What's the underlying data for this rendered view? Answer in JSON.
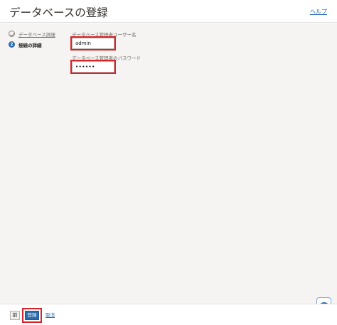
{
  "header": {
    "title": "データベースの登録",
    "help_label": "ヘルプ"
  },
  "steps": [
    {
      "label": "データベース詳細",
      "state": "done",
      "number": ""
    },
    {
      "label": "接続の詳細",
      "state": "current",
      "number": "2"
    }
  ],
  "form": {
    "username_label": "データベース管理者ユーザー名",
    "username_value": "admin",
    "password_label": "データベース管理者のパスワード",
    "password_value": "••••••"
  },
  "footer": {
    "prev_label": "前",
    "register_label": "登録",
    "cancel_label": "取消"
  },
  "colors": {
    "accent": "#2c6bb0",
    "highlight": "#d8232a",
    "panel": "#f5f4f2"
  },
  "icons": {
    "support": "help-support-icon",
    "step_done": "check-circle-icon"
  }
}
